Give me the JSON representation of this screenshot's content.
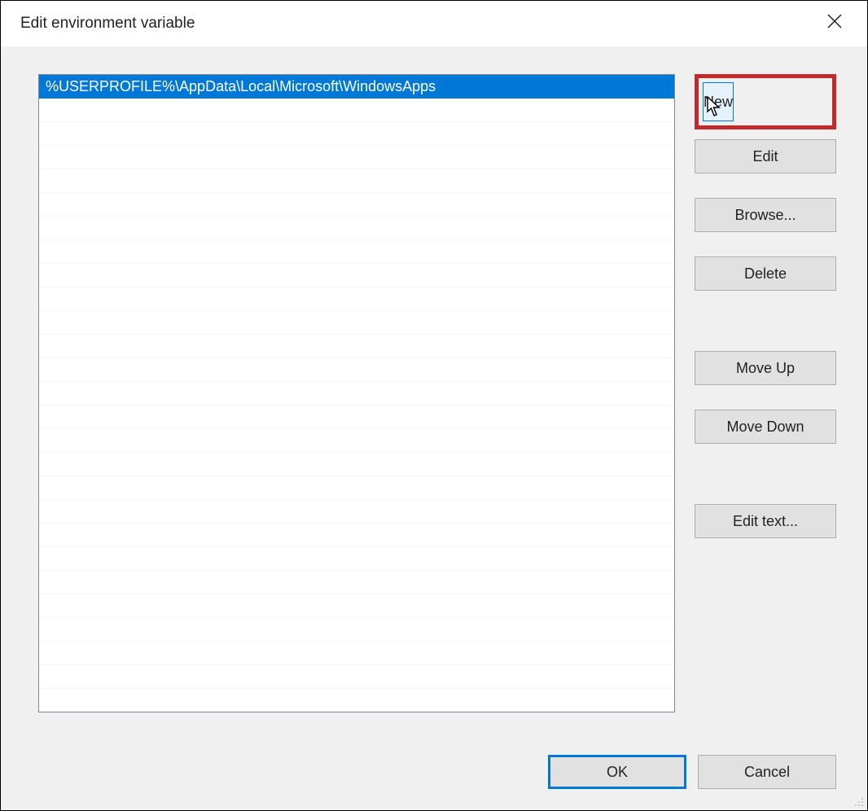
{
  "window": {
    "title": "Edit environment variable"
  },
  "list": {
    "items": [
      "%USERPROFILE%\\AppData\\Local\\Microsoft\\WindowsApps"
    ],
    "selectedIndex": 0,
    "visibleRows": 26
  },
  "buttons": {
    "new": "New",
    "edit": "Edit",
    "browse": "Browse...",
    "delete": "Delete",
    "moveUp": "Move Up",
    "moveDown": "Move Down",
    "editText": "Edit text..."
  },
  "footer": {
    "ok": "OK",
    "cancel": "Cancel"
  }
}
